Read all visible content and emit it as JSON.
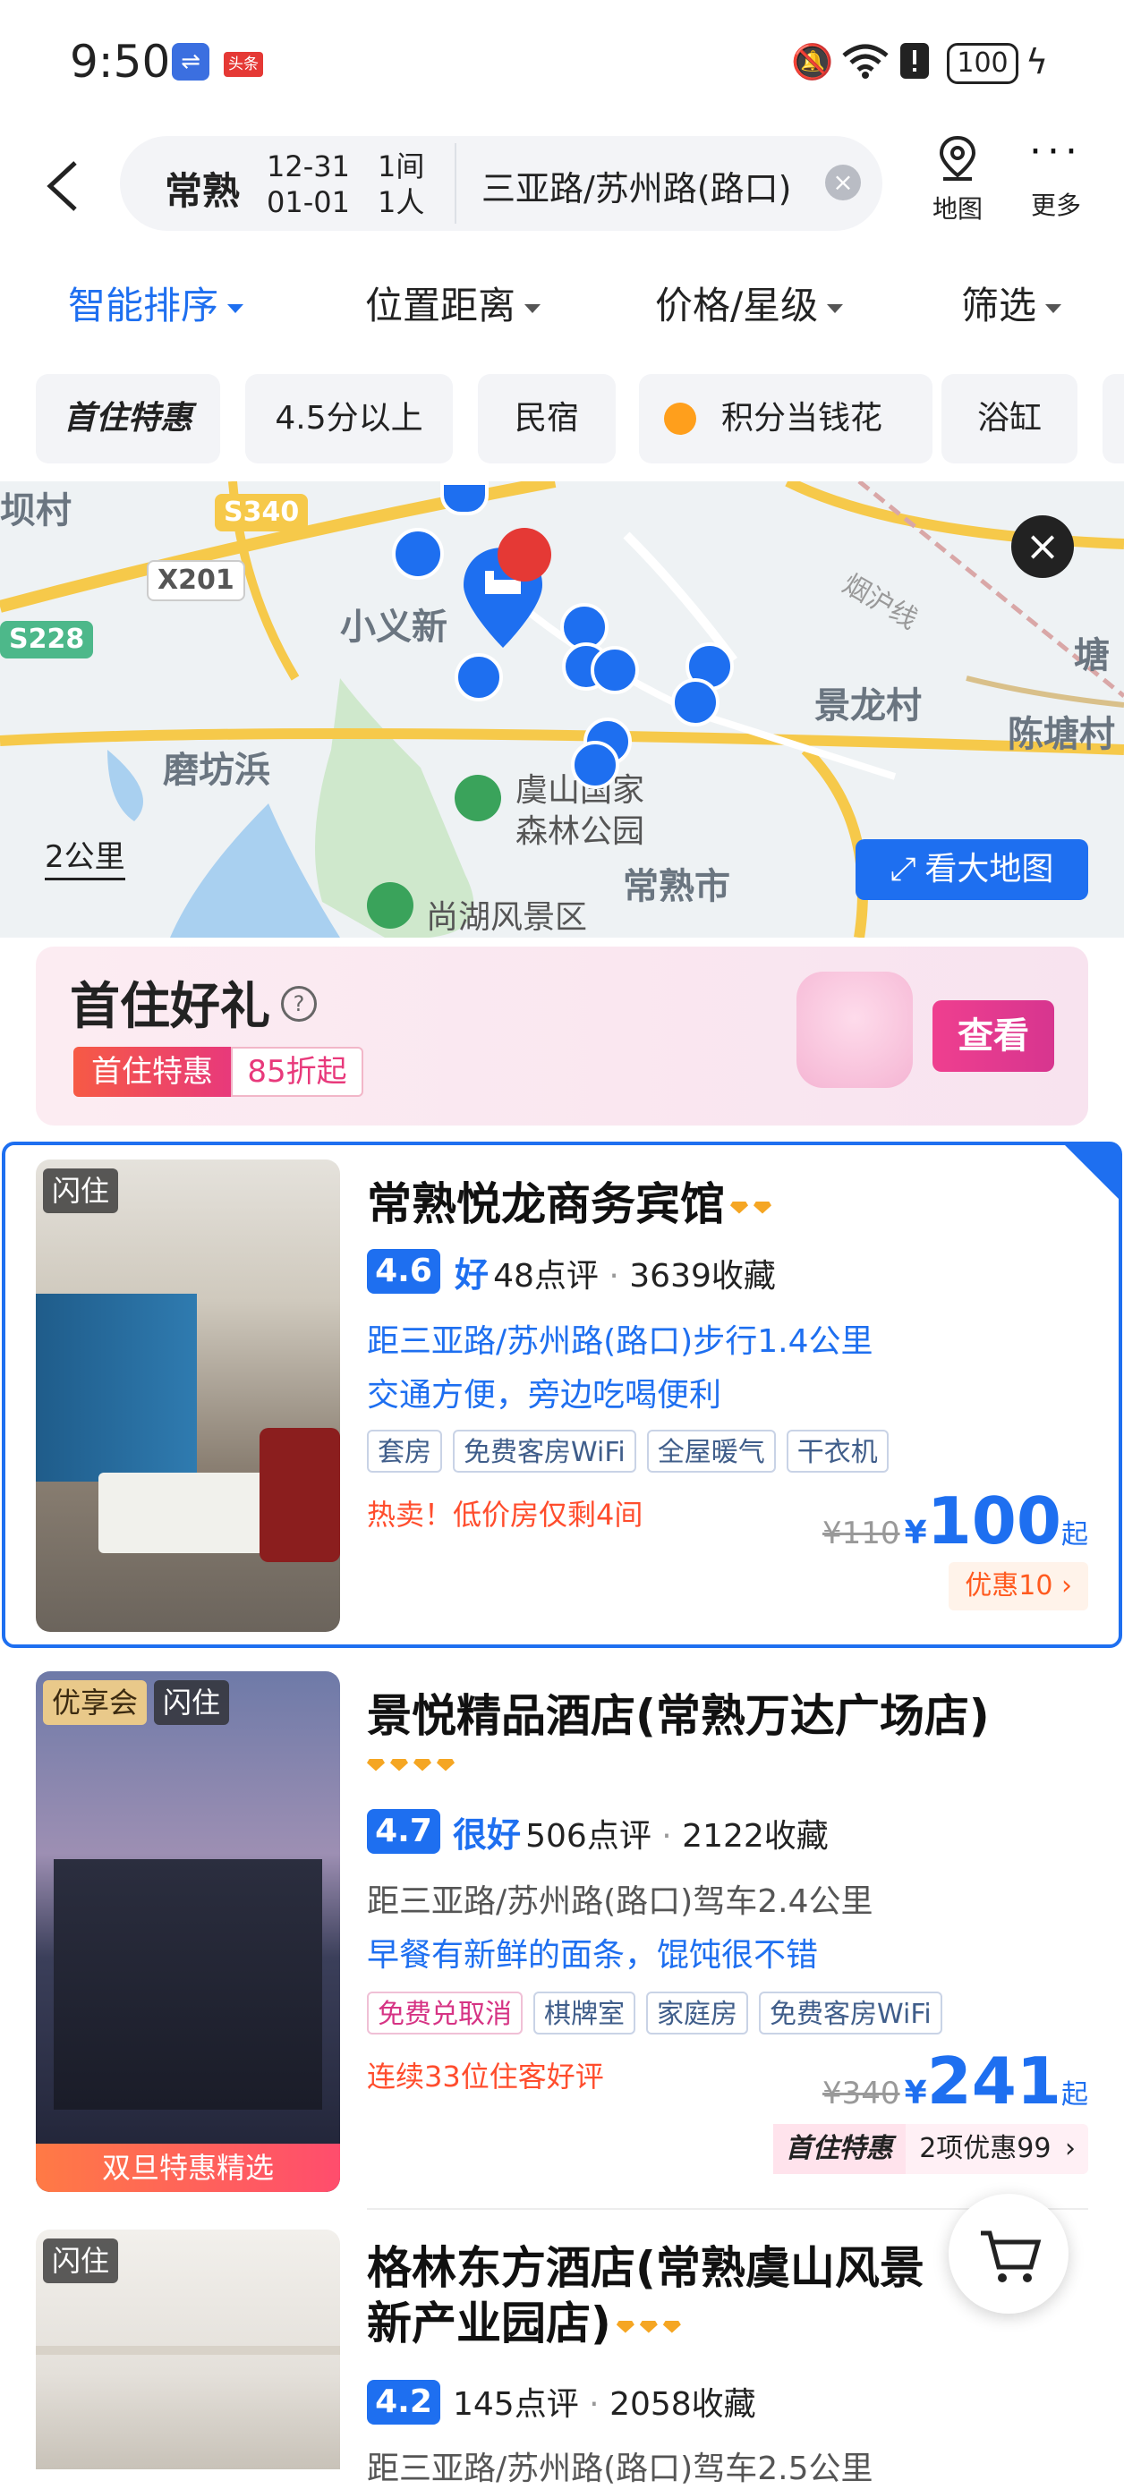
{
  "status_bar": {
    "time": "9:50",
    "toutiao": "头条",
    "battery": "100"
  },
  "search": {
    "city": "常熟",
    "checkin": "12-31",
    "checkout": "01-01",
    "rooms": "1间",
    "guests": "1人",
    "keyword": "三亚路/苏州路(路口)",
    "map_label": "地图",
    "more_label": "更多"
  },
  "sort_tabs": [
    "智能排序",
    "位置距离",
    "价格/星级",
    "筛选"
  ],
  "chips": [
    "首住特惠",
    "4.5分以上",
    "民宿",
    "积分当钱花",
    "浴缸"
  ],
  "map": {
    "places": [
      "小义新",
      "磨坊浜",
      "景龙村",
      "陈塘村",
      "虞山国家",
      "森林公园",
      "常熟市",
      "尚湖风景区",
      "烟沪线",
      "塘",
      "坝村"
    ],
    "roads": [
      "S340",
      "X201",
      "S228"
    ],
    "scale": "2公里",
    "big_map_button": "看大地图"
  },
  "banner": {
    "title": "首住好礼",
    "badge_left": "首住特惠",
    "badge_right": "85折起",
    "button": "查看"
  },
  "hotels": [
    {
      "tags": [
        "闪住"
      ],
      "name": "常熟悦龙商务宾馆",
      "diamonds": 2,
      "score": "4.6",
      "score_word": "好",
      "reviews": "48点评",
      "favorites": "3639收藏",
      "distance": "距三亚路/苏州路(路口)步行1.4公里",
      "highlight": "交通方便，旁边吃喝便利",
      "amenities": [
        "套房",
        "免费客房WiFi",
        "全屋暖气",
        "干衣机"
      ],
      "promo": "热卖！低价房仅剩4间",
      "old_price": "¥110",
      "price": "100",
      "price_suffix": "起",
      "deal": "优惠10"
    },
    {
      "tags": [
        "优享会",
        "闪住"
      ],
      "photo_banner": "双旦特惠精选",
      "name": "景悦精品酒店(常熟万达广场店)",
      "diamonds": 4,
      "score": "4.7",
      "score_word": "很好",
      "reviews": "506点评",
      "favorites": "2122收藏",
      "distance": "距三亚路/苏州路(路口)驾车2.4公里",
      "highlight": "早餐有新鲜的面条，馄饨很不错",
      "amenities": [
        "免费兑取消",
        "棋牌室",
        "家庭房",
        "免费客房WiFi"
      ],
      "promo": "连续33位住客好评",
      "old_price": "¥340",
      "price": "241",
      "price_suffix": "起",
      "deal_tag": "首住特惠",
      "deal": "2项优惠99"
    },
    {
      "tags": [
        "闪住"
      ],
      "name_line1": "格林东方酒店(常熟虞山风景",
      "name_line2": "新产业园店)",
      "diamonds": 3,
      "score": "4.2",
      "reviews": "145点评",
      "favorites": "2058收藏",
      "distance": "距三亚路/苏州路(路口)驾车2.5公里"
    }
  ],
  "colors": {
    "accent": "#1e6ff0",
    "promo": "#ff4d2d",
    "pink": "#e8397b"
  }
}
